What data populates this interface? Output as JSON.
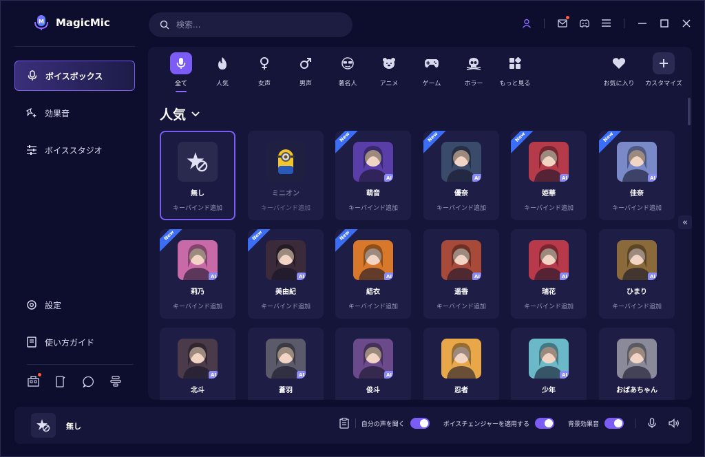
{
  "app": {
    "name": "MagicMic"
  },
  "search": {
    "placeholder": "検索..."
  },
  "window_controls": [
    "user-icon",
    "mail-icon",
    "discord-icon",
    "menu-icon",
    "minimize-icon",
    "maximize-icon",
    "close-icon"
  ],
  "sidebar": {
    "items": [
      {
        "label": "ボイスボックス",
        "icon": "microphone-icon",
        "active": true
      },
      {
        "label": "効果音",
        "icon": "sparkle-icon",
        "active": false
      },
      {
        "label": "ボイススタジオ",
        "icon": "sliders-icon",
        "active": false
      },
      {
        "label": "設定",
        "icon": "gear-icon",
        "active": false
      },
      {
        "label": "使い方ガイド",
        "icon": "book-icon",
        "active": false
      }
    ]
  },
  "categories": [
    {
      "label": "全て",
      "icon": "mic-icon",
      "active": true
    },
    {
      "label": "人気",
      "icon": "flame-icon"
    },
    {
      "label": "女声",
      "icon": "female-icon"
    },
    {
      "label": "男声",
      "icon": "male-icon"
    },
    {
      "label": "著名人",
      "icon": "sunglasses-icon"
    },
    {
      "label": "アニメ",
      "icon": "bear-icon"
    },
    {
      "label": "ゲーム",
      "icon": "gamepad-icon"
    },
    {
      "label": "ホラー",
      "icon": "skull-icon"
    },
    {
      "label": "もっと見る",
      "icon": "grid-icon"
    },
    {
      "label": "お気に入り",
      "icon": "heart-icon"
    },
    {
      "label": "カスタマイズ",
      "icon": "plus-icon"
    }
  ],
  "section": {
    "title": "人気"
  },
  "voice_sub": "キーバインド追加",
  "voices": [
    {
      "name": "無し",
      "new": false,
      "ai": false,
      "selected": true,
      "color": "#2a2a4e"
    },
    {
      "name": "ミニオン",
      "new": false,
      "ai": false,
      "dim": true,
      "color": "#1f1f42"
    },
    {
      "name": "萌音",
      "new": true,
      "ai": true,
      "color": "#5a3ea8"
    },
    {
      "name": "優奈",
      "new": true,
      "ai": true,
      "color": "#3a4a6a"
    },
    {
      "name": "姫華",
      "new": true,
      "ai": true,
      "color": "#b53a4a"
    },
    {
      "name": "佳奈",
      "new": true,
      "ai": true,
      "color": "#7a8ac8"
    },
    {
      "name": "莉乃",
      "new": true,
      "ai": true,
      "color": "#c86aa8"
    },
    {
      "name": "美由紀",
      "new": true,
      "ai": true,
      "color": "#3a2a3a"
    },
    {
      "name": "結衣",
      "new": true,
      "ai": true,
      "color": "#d8782a"
    },
    {
      "name": "遥香",
      "new": false,
      "ai": true,
      "color": "#a84a3a"
    },
    {
      "name": "瑞花",
      "new": false,
      "ai": true,
      "color": "#b83a4a"
    },
    {
      "name": "ひまり",
      "new": false,
      "ai": true,
      "color": "#8a6a3a"
    },
    {
      "name": "北斗",
      "new": false,
      "ai": true,
      "color": "#4a3a4a"
    },
    {
      "name": "蒼羽",
      "new": false,
      "ai": true,
      "color": "#5a5a6a"
    },
    {
      "name": "俊斗",
      "new": false,
      "ai": true,
      "color": "#6a4a8a"
    },
    {
      "name": "忍者",
      "new": false,
      "ai": false,
      "color": "#e8a84a"
    },
    {
      "name": "少年",
      "new": false,
      "ai": true,
      "color": "#6ab8c8"
    },
    {
      "name": "おばあちゃん",
      "new": false,
      "ai": false,
      "color": "#8a8a9a"
    }
  ],
  "new_label": "New",
  "ai_label": "AI",
  "footer": {
    "current_voice": "無し",
    "listen_label": "自分の声を聞く",
    "apply_label": "ボイスチェンジャーを適用する",
    "bgm_label": "背景効果音",
    "listen_on": true,
    "apply_on": true,
    "bgm_on": true
  },
  "colors": {
    "accent": "#7b5cf5",
    "new_badge": "#3b6ef5",
    "background": "#0d0d2e",
    "panel": "#15153a"
  }
}
